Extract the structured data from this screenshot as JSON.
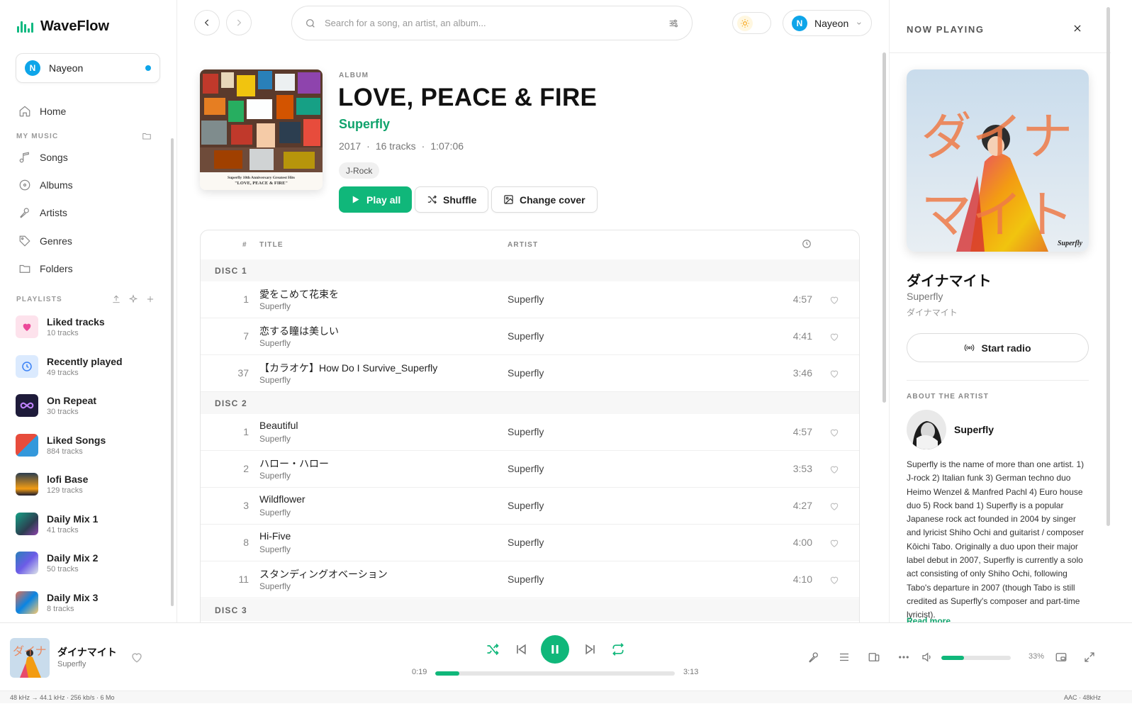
{
  "app": {
    "name": "WaveFlow"
  },
  "user": {
    "name": "Nayeon",
    "initial": "N"
  },
  "nav": {
    "home": "Home",
    "my_music_label": "MY MUSIC",
    "songs": "Songs",
    "albums": "Albums",
    "artists": "Artists",
    "genres": "Genres",
    "folders": "Folders"
  },
  "playlists": {
    "label": "PLAYLISTS",
    "items": [
      {
        "name": "Liked tracks",
        "count": "10 tracks"
      },
      {
        "name": "Recently played",
        "count": "49 tracks"
      },
      {
        "name": "On Repeat",
        "count": "30 tracks"
      },
      {
        "name": "Liked Songs",
        "count": "884 tracks"
      },
      {
        "name": "lofi Base",
        "count": "129 tracks"
      },
      {
        "name": "Daily Mix 1",
        "count": "41 tracks"
      },
      {
        "name": "Daily Mix 2",
        "count": "50 tracks"
      },
      {
        "name": "Daily Mix 3",
        "count": "8 tracks"
      }
    ]
  },
  "search": {
    "placeholder": "Search for a song, an artist, an album..."
  },
  "album": {
    "type_label": "ALBUM",
    "title": "LOVE, PEACE & FIRE",
    "artist": "Superfly",
    "year": "2017",
    "tracks": "16 tracks",
    "duration": "1:07:06",
    "sep": "·",
    "genre": "J-Rock",
    "cover_caption_1": "Superfly 10th Anniversary Greatest Hits",
    "cover_caption_2": "\"LOVE, PEACE & FIRE\"",
    "buttons": {
      "play_all": "Play all",
      "shuffle": "Shuffle",
      "change_cover": "Change cover"
    }
  },
  "table": {
    "headers": {
      "num": "#",
      "title": "TITLE",
      "artist": "ARTIST"
    },
    "discs": [
      {
        "label": "DISC 1",
        "tracks": [
          {
            "num": "1",
            "title": "愛をこめて花束を",
            "sub": "Superfly",
            "artist": "Superfly",
            "duration": "4:57"
          },
          {
            "num": "7",
            "title": "恋する瞳は美しい",
            "sub": "Superfly",
            "artist": "Superfly",
            "duration": "4:41"
          },
          {
            "num": "37",
            "title": "【カラオケ】How Do I Survive_Superfly",
            "sub": "Superfly",
            "artist": "Superfly",
            "duration": "3:46"
          }
        ]
      },
      {
        "label": "DISC 2",
        "tracks": [
          {
            "num": "1",
            "title": "Beautiful",
            "sub": "Superfly",
            "artist": "Superfly",
            "duration": "4:57"
          },
          {
            "num": "2",
            "title": "ハロー・ハロー",
            "sub": "Superfly",
            "artist": "Superfly",
            "duration": "3:53"
          },
          {
            "num": "3",
            "title": "Wildflower",
            "sub": "Superfly",
            "artist": "Superfly",
            "duration": "4:27"
          },
          {
            "num": "8",
            "title": "Hi-Five",
            "sub": "Superfly",
            "artist": "Superfly",
            "duration": "4:00"
          },
          {
            "num": "11",
            "title": "スタンディングオベーション",
            "sub": "Superfly",
            "artist": "Superfly",
            "duration": "4:10"
          }
        ]
      },
      {
        "label": "DISC 3",
        "tracks": []
      }
    ]
  },
  "now_playing": {
    "header": "NOW PLAYING",
    "title": "ダイナマイト",
    "artist": "Superfly",
    "album": "ダイナマイト",
    "art_text_1": "ダイナ",
    "art_text_2": "マイト",
    "art_brand": "Superfly",
    "radio": "Start radio",
    "about_label": "ABOUT THE ARTIST",
    "artist_name": "Superfly",
    "bio": "Superfly is the name of more than one artist. 1) J-rock 2) Italian funk 3) German techno duo Heimo Wenzel & Manfred Pachl 4) Euro house duo 5) Rock band 1) Superfly is a popular Japanese rock act founded in 2004 by singer and lyricist Shiho Ochi and guitarist / composer Kôichi Tabo. Originally a duo upon their major label debut in 2007, Superfly is currently a solo act consisting of only Shiho Ochi, following Tabo's departure in 2007 (though Tabo is still credited as Superfly's composer and part-time lyricist).",
    "read_more": "Read more"
  },
  "player": {
    "title": "ダイナマイト",
    "artist": "Superfly",
    "elapsed": "0:19",
    "total": "3:13",
    "progress_pct": 10,
    "volume_pct": 33,
    "volume_label": "33%"
  },
  "status": {
    "left": "48 kHz → 44.1 kHz · 256 kb/s · 6 Mo",
    "right": "AAC · 48kHz"
  },
  "colors": {
    "accent": "#10b77a",
    "accent_text": "#10a36c",
    "user": "#0ea5e9"
  }
}
